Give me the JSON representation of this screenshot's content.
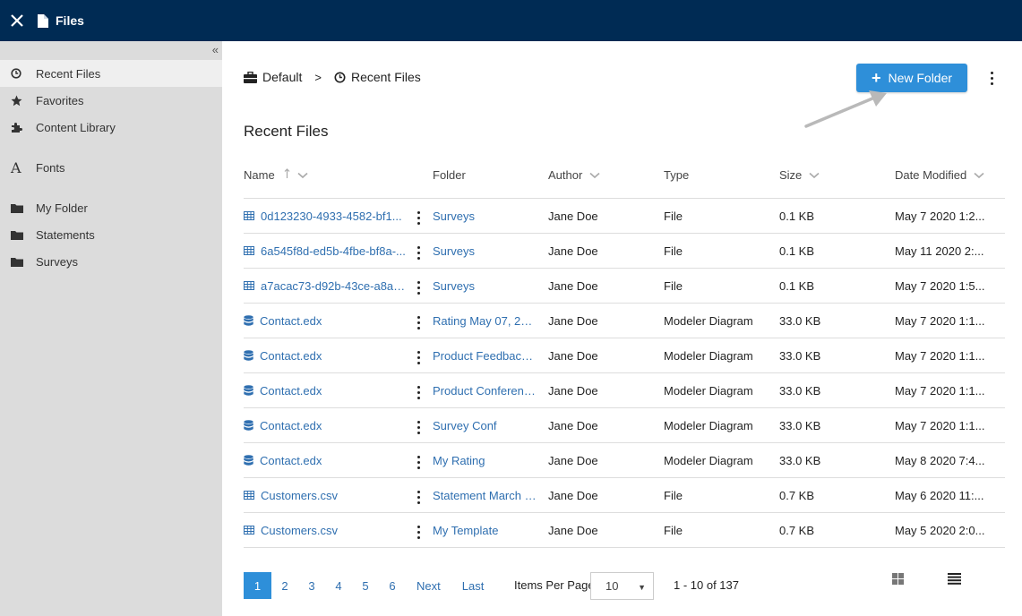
{
  "topbar": {
    "title": "Files",
    "close_icon": "close-icon",
    "file_icon": "file-icon"
  },
  "sidebar": {
    "collapse": "«",
    "items": [
      {
        "label": "Recent Files",
        "icon": "clock-icon",
        "active": true
      },
      {
        "label": "Favorites",
        "icon": "star-icon"
      },
      {
        "label": "Content Library",
        "icon": "puzzle-icon"
      },
      {
        "label": "Fonts",
        "icon": "font-icon"
      },
      {
        "label": "My Folder",
        "icon": "folder-icon"
      },
      {
        "label": "Statements",
        "icon": "folder-icon"
      },
      {
        "label": "Surveys",
        "icon": "folder-icon"
      }
    ]
  },
  "breadcrumb": {
    "root": "Default",
    "separator": ">",
    "current": "Recent Files"
  },
  "toolbar": {
    "new_folder": "New Folder",
    "new_folder_color": "#2e8fd9"
  },
  "page": {
    "heading": "Recent Files"
  },
  "table": {
    "columns": {
      "name": "Name",
      "folder": "Folder",
      "author": "Author",
      "type": "Type",
      "size": "Size",
      "date": "Date Modified"
    },
    "rows": [
      {
        "name": "0d123230-4933-4582-bf1...",
        "icon": "table-icon",
        "folder": "Surveys",
        "author": "Jane Doe",
        "type": "File",
        "size": "0.1 KB",
        "date": "May 7 2020 1:2..."
      },
      {
        "name": "6a545f8d-ed5b-4fbe-bf8a-...",
        "icon": "table-icon",
        "folder": "Surveys",
        "author": "Jane Doe",
        "type": "File",
        "size": "0.1 KB",
        "date": "May 11 2020 2:..."
      },
      {
        "name": "a7acac73-d92b-43ce-a8a5-...",
        "icon": "table-icon",
        "folder": "Surveys",
        "author": "Jane Doe",
        "type": "File",
        "size": "0.1 KB",
        "date": "May 7 2020 1:5..."
      },
      {
        "name": "Contact.edx",
        "icon": "database-icon",
        "folder": "Rating May 07, 2020",
        "author": "Jane Doe",
        "type": "Modeler Diagram",
        "size": "33.0 KB",
        "date": "May 7 2020 1:1..."
      },
      {
        "name": "Contact.edx",
        "icon": "database-icon",
        "folder": "Product Feedback ...",
        "author": "Jane Doe",
        "type": "Modeler Diagram",
        "size": "33.0 KB",
        "date": "May 7 2020 1:1..."
      },
      {
        "name": "Contact.edx",
        "icon": "database-icon",
        "folder": "Product Conferenc...",
        "author": "Jane Doe",
        "type": "Modeler Diagram",
        "size": "33.0 KB",
        "date": "May 7 2020 1:1..."
      },
      {
        "name": "Contact.edx",
        "icon": "database-icon",
        "folder": "Survey Conf",
        "author": "Jane Doe",
        "type": "Modeler Diagram",
        "size": "33.0 KB",
        "date": "May 7 2020 1:1..."
      },
      {
        "name": "Contact.edx",
        "icon": "database-icon",
        "folder": "My Rating",
        "author": "Jane Doe",
        "type": "Modeler Diagram",
        "size": "33.0 KB",
        "date": "May 8 2020 7:4..."
      },
      {
        "name": "Customers.csv",
        "icon": "table-icon",
        "folder": "Statement March 2...",
        "author": "Jane Doe",
        "type": "File",
        "size": "0.7 KB",
        "date": "May 6 2020 11:..."
      },
      {
        "name": "Customers.csv",
        "icon": "table-icon",
        "folder": "My Template",
        "author": "Jane Doe",
        "type": "File",
        "size": "0.7 KB",
        "date": "May 5 2020 2:0..."
      }
    ]
  },
  "pagination": {
    "pages": [
      "1",
      "2",
      "3",
      "4",
      "5",
      "6"
    ],
    "active": "1",
    "next": "Next",
    "last": "Last",
    "items_per_page_label": "Items Per Page",
    "items_per_page": "10",
    "range": "1 - 10 of 137"
  }
}
